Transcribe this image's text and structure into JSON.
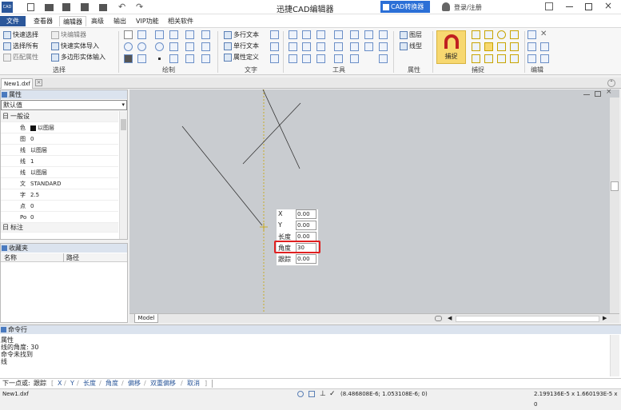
{
  "titlebar": {
    "title": "迅捷CAD编辑器",
    "converter": "CAD转换器",
    "login": "登录/注册"
  },
  "menu": {
    "items": [
      "文件",
      "查看器",
      "编辑器",
      "高级",
      "输出",
      "VIP功能",
      "相关软件"
    ]
  },
  "ribbon": {
    "select": {
      "items": [
        "快速选择",
        "选择所有",
        "匹配属性",
        "块编辑器",
        "快速实体导入",
        "多边形实体输入"
      ],
      "label": "选择"
    },
    "draw": {
      "label": "绘制"
    },
    "text": {
      "items": [
        "多行文本",
        "单行文本",
        "属性定义"
      ],
      "label": "文字"
    },
    "tools": {
      "label": "工具"
    },
    "props": {
      "items": [
        "图层",
        "线型"
      ],
      "label": "属性"
    },
    "snap": {
      "button": "捕捉",
      "label": "捕捉"
    },
    "edit": {
      "label": "编辑"
    }
  },
  "doc_tab": "New1.dxf",
  "properties": {
    "title": "属性",
    "dropdown": "默认值",
    "section_general": "一般设",
    "rows": [
      {
        "k": "色",
        "v": "以图层"
      },
      {
        "k": "图",
        "v": "0"
      },
      {
        "k": "线",
        "v": "以图层"
      },
      {
        "k": "线",
        "v": "1"
      },
      {
        "k": "线",
        "v": "以图层"
      },
      {
        "k": "文",
        "v": "STANDARD"
      },
      {
        "k": "字",
        "v": "2.5"
      },
      {
        "k": "点",
        "v": "0"
      },
      {
        "k": "Po",
        "v": "0"
      }
    ],
    "section_label": "标注"
  },
  "favorites": {
    "title": "收藏夹",
    "col_name": "名称",
    "col_path": "路径"
  },
  "canvas": {
    "model_tab": "Model"
  },
  "dynamic_input": {
    "x_label": "X",
    "x_value": "0.00",
    "y_label": "Y",
    "y_value": "0.00",
    "len_label": "长度",
    "len_value": "0.00",
    "angle_label": "角度",
    "angle_value": "30",
    "track_label": "跟踪",
    "track_value": "0.00"
  },
  "command": {
    "title": "命令行",
    "history": [
      "属性",
      "线的角度: 30",
      "命令未找到",
      "线"
    ],
    "prompt_prefix": "下一点或:",
    "prompt_items": [
      "跟踪",
      "X",
      "Y",
      "长度",
      "角度",
      "偏移",
      "双重偏移",
      "取消"
    ]
  },
  "status": {
    "filename": "New1.dxf",
    "coords": "(8.486808E-6; 1.053108E-6; 0)",
    "size": "2.199136E-5 x 1.660193E-5 x 0"
  },
  "colors": {
    "accent": "#2b579a",
    "highlight": "#e02020",
    "canvas": "#c9ccd0",
    "snap_bg": "#f7d870",
    "crosshair": "#c8a400"
  }
}
